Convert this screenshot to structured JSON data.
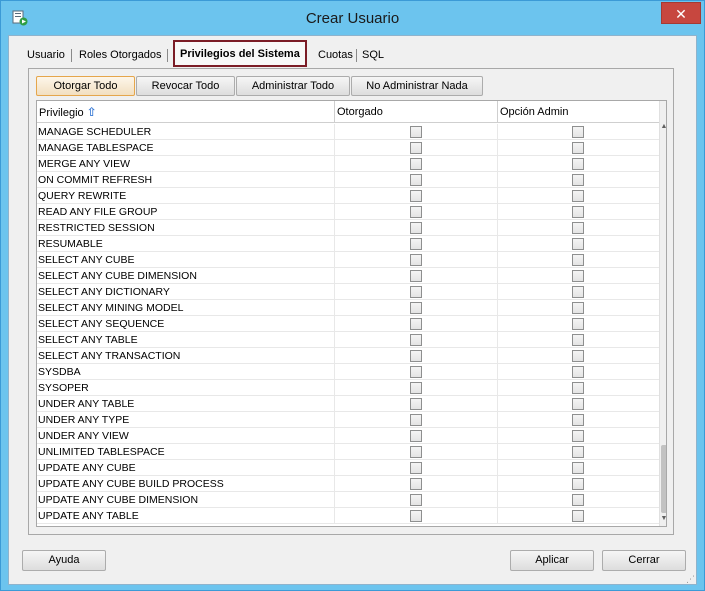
{
  "window": {
    "title": "Crear Usuario",
    "close_glyph": "✕",
    "app_icon": "sql-developer-icon"
  },
  "tabs": [
    {
      "label": "Usuario"
    },
    {
      "label": "Roles Otorgados"
    },
    {
      "label": "Privilegios del Sistema",
      "active": true
    },
    {
      "label": "Cuotas"
    },
    {
      "label": "SQL"
    }
  ],
  "toolbar": {
    "grant_all": "Otorgar Todo",
    "revoke_all": "Revocar Todo",
    "admin_all": "Administrar Todo",
    "admin_none": "No Administrar Nada"
  },
  "grid": {
    "columns": {
      "privilege": "Privilegio",
      "granted": "Otorgado",
      "admin_option": "Opción Admin"
    },
    "sort_icon": "sort-ascending-icon",
    "rows": [
      {
        "name": "MANAGE SCHEDULER",
        "granted": false,
        "admin": false
      },
      {
        "name": "MANAGE TABLESPACE",
        "granted": false,
        "admin": false
      },
      {
        "name": "MERGE ANY VIEW",
        "granted": false,
        "admin": false
      },
      {
        "name": "ON COMMIT REFRESH",
        "granted": false,
        "admin": false
      },
      {
        "name": "QUERY REWRITE",
        "granted": false,
        "admin": false
      },
      {
        "name": "READ ANY FILE GROUP",
        "granted": false,
        "admin": false
      },
      {
        "name": "RESTRICTED SESSION",
        "granted": false,
        "admin": false
      },
      {
        "name": "RESUMABLE",
        "granted": false,
        "admin": false
      },
      {
        "name": "SELECT ANY CUBE",
        "granted": false,
        "admin": false
      },
      {
        "name": "SELECT ANY CUBE DIMENSION",
        "granted": false,
        "admin": false
      },
      {
        "name": "SELECT ANY DICTIONARY",
        "granted": false,
        "admin": false
      },
      {
        "name": "SELECT ANY MINING MODEL",
        "granted": false,
        "admin": false
      },
      {
        "name": "SELECT ANY SEQUENCE",
        "granted": false,
        "admin": false
      },
      {
        "name": "SELECT ANY TABLE",
        "granted": false,
        "admin": false
      },
      {
        "name": "SELECT ANY TRANSACTION",
        "granted": false,
        "admin": false
      },
      {
        "name": "SYSDBA",
        "granted": false,
        "admin": false
      },
      {
        "name": "SYSOPER",
        "granted": false,
        "admin": false
      },
      {
        "name": "UNDER ANY TABLE",
        "granted": false,
        "admin": false
      },
      {
        "name": "UNDER ANY TYPE",
        "granted": false,
        "admin": false
      },
      {
        "name": "UNDER ANY VIEW",
        "granted": false,
        "admin": false
      },
      {
        "name": "UNLIMITED TABLESPACE",
        "granted": false,
        "admin": false
      },
      {
        "name": "UPDATE ANY CUBE",
        "granted": false,
        "admin": false
      },
      {
        "name": "UPDATE ANY CUBE BUILD PROCESS",
        "granted": false,
        "admin": false
      },
      {
        "name": "UPDATE ANY CUBE DIMENSION",
        "granted": false,
        "admin": false
      },
      {
        "name": "UPDATE ANY TABLE",
        "granted": false,
        "admin": false
      }
    ]
  },
  "footer": {
    "help": "Ayuda",
    "apply": "Aplicar",
    "close": "Cerrar"
  },
  "colors": {
    "window_border": "#6cc4ee",
    "active_tab_border": "#7b1c26",
    "close_button": "#c7473f",
    "focused_button_border": "#e5a64c"
  }
}
